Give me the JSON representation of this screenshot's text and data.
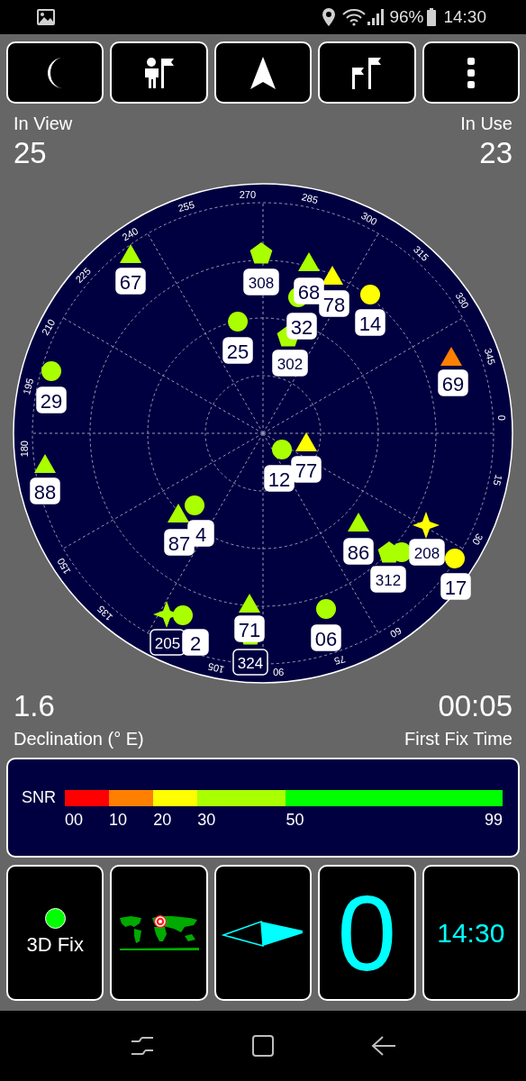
{
  "status_bar": {
    "battery": "96%",
    "time": "14:30"
  },
  "toolbar": {
    "buttons": [
      {
        "kind": "moon"
      },
      {
        "kind": "person-flag"
      },
      {
        "kind": "navigation"
      },
      {
        "kind": "flags"
      },
      {
        "kind": "more"
      }
    ]
  },
  "in_view": {
    "label": "In View",
    "value": "25"
  },
  "in_use": {
    "label": "In Use",
    "value": "23"
  },
  "sky_plot": {
    "azimuth_labels": [
      "0",
      "15",
      "30",
      "60",
      "75",
      "90",
      "105",
      "135",
      "150",
      "180",
      "195",
      "210",
      "225",
      "240",
      "255",
      "270",
      "285",
      "300",
      "315",
      "330",
      "345"
    ],
    "satellites": [
      {
        "label": "67",
        "color": "#aaff00",
        "kind": "triangle",
        "used": true
      },
      {
        "label": "29",
        "color": "#aaff00",
        "kind": "circle",
        "used": true
      },
      {
        "label": "88",
        "color": "#aaff00",
        "kind": "triangle",
        "used": true
      },
      {
        "label": "308",
        "color": "#aaff00",
        "kind": "pentagon",
        "used": true
      },
      {
        "label": "68",
        "color": "#aaff00",
        "kind": "triangle",
        "used": true
      },
      {
        "label": "32",
        "color": "#aaff00",
        "kind": "circle",
        "used": true
      },
      {
        "label": "78",
        "color": "#ffff00",
        "kind": "triangle",
        "used": true
      },
      {
        "label": "14",
        "color": "#ffff00",
        "kind": "circle",
        "used": true
      },
      {
        "label": "25",
        "color": "#aaff00",
        "kind": "circle",
        "used": true
      },
      {
        "label": "302",
        "color": "#aaff00",
        "kind": "pentagon",
        "used": true
      },
      {
        "label": "69",
        "color": "#ff8000",
        "kind": "triangle",
        "used": true
      },
      {
        "label": "12",
        "color": "#aaff00",
        "kind": "circle",
        "used": true
      },
      {
        "label": "77",
        "color": "#ffff00",
        "kind": "triangle",
        "used": true
      },
      {
        "label": "4",
        "color": "#aaff00",
        "kind": "circle",
        "used": true
      },
      {
        "label": "87",
        "color": "#aaff00",
        "kind": "triangle",
        "used": true
      },
      {
        "label": "205",
        "color": "#aaff00",
        "kind": "star",
        "used": false
      },
      {
        "label": "2",
        "color": "#aaff00",
        "kind": "circle",
        "used": true
      },
      {
        "label": "71",
        "color": "#aaff00",
        "kind": "triangle",
        "used": true
      },
      {
        "label": "324",
        "color": "#aaff00",
        "kind": "pentagon",
        "used": false
      },
      {
        "label": "06",
        "color": "#aaff00",
        "kind": "circle",
        "used": true
      },
      {
        "label": "86",
        "color": "#aaff00",
        "kind": "triangle",
        "used": true
      },
      {
        "color": "#aaff00",
        "kind": "circle"
      },
      {
        "label": "312",
        "color": "#aaff00",
        "kind": "pentagon",
        "used": true
      },
      {
        "label": "208",
        "color": "#ffff00",
        "kind": "star",
        "used": true
      },
      {
        "label": "17",
        "color": "#ffff00",
        "kind": "circle",
        "used": true
      }
    ]
  },
  "declination": {
    "value": "1.6",
    "label": "Declination (° E)"
  },
  "first_fix": {
    "value": "00:05",
    "label": "First Fix Time"
  },
  "snr_legend": {
    "label": "SNR",
    "segments": [
      {
        "label": "00",
        "color": "#ff0000"
      },
      {
        "label": "10",
        "color": "#ff8000"
      },
      {
        "label": "20",
        "color": "#ffff00"
      },
      {
        "label": "30",
        "color": "#aaff00"
      },
      {
        "label": "50",
        "color": "#00ff00"
      }
    ],
    "end_label": "99"
  },
  "tiles": [
    {
      "kind": "fix",
      "label": "3D Fix",
      "color": "#00ff00"
    },
    {
      "kind": "map"
    },
    {
      "kind": "compass"
    },
    {
      "kind": "value",
      "value": "0"
    },
    {
      "kind": "clock",
      "value": "14:30"
    }
  ]
}
